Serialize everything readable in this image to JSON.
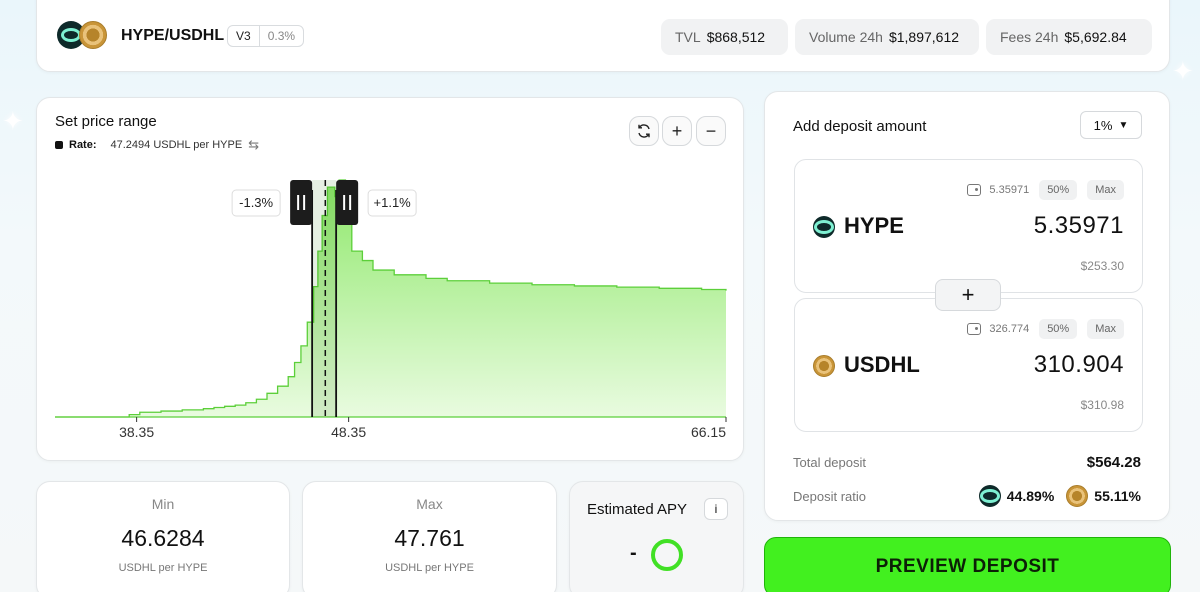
{
  "header": {
    "pair": "HYPE/USDHL",
    "version": "V3",
    "fee": "0.3%",
    "stats": [
      {
        "label": "TVL",
        "value": "$868,512"
      },
      {
        "label": "Volume 24h",
        "value": "$1,897,612"
      },
      {
        "label": "Fees 24h",
        "value": "$5,692.84"
      }
    ]
  },
  "range": {
    "title": "Set price range",
    "rate_label": "Rate:",
    "rate_value": "47.2494 USDHL per HYPE",
    "controls": [
      "refresh-icon",
      "zoom-in-icon",
      "zoom-out-icon"
    ]
  },
  "chart_data": {
    "type": "area",
    "x_ticks": [
      "38.35",
      "48.35",
      "66.15"
    ],
    "xlim": [
      34.5,
      66.15
    ],
    "current_price": 47.2494,
    "min_price": 46.6284,
    "max_price": 47.761,
    "min_label": "-1.3%",
    "max_label": "+1.1%",
    "x": [
      34.5,
      37.5,
      38.0,
      38.5,
      39.5,
      40.5,
      41.5,
      42.0,
      42.5,
      43.0,
      43.5,
      44.0,
      44.5,
      45.0,
      45.5,
      45.8,
      46.1,
      46.4,
      46.7,
      46.9,
      47.1,
      47.35,
      47.7,
      47.9,
      48.2,
      48.5,
      49.0,
      49.5,
      50.5,
      52.0,
      53.0,
      55.0,
      57.0,
      59.0,
      61.0,
      63.0,
      65.0,
      66.15
    ],
    "liquidity": [
      0,
      0,
      1,
      2,
      2.5,
      3,
      3.5,
      4,
      4.5,
      5,
      6,
      7.5,
      10,
      13,
      17,
      23,
      30,
      40,
      55,
      70,
      85,
      97,
      93,
      100,
      82,
      70,
      66,
      62,
      60,
      58.5,
      57.5,
      56.5,
      55.8,
      55.3,
      54.8,
      54.3,
      53.8,
      53.3
    ],
    "colors": {
      "fill_top": "#8ee86a",
      "fill_bottom": "#e9fbe0",
      "line": "#5ccf3a",
      "handle": "#1c1c1c"
    }
  },
  "min": {
    "title": "Min",
    "value": "46.6284",
    "unit": "USDHL per HYPE"
  },
  "max": {
    "title": "Max",
    "value": "47.761",
    "unit": "USDHL per HYPE"
  },
  "apy": {
    "title": "Estimated APY",
    "info": "i",
    "value": "-"
  },
  "deposit": {
    "title": "Add deposit amount",
    "slippage": "1%",
    "tokens": [
      {
        "name": "HYPE",
        "balance": "5.35971",
        "half": "50%",
        "max": "Max",
        "amount": "5.35971",
        "usd": "$253.30"
      },
      {
        "name": "USDHL",
        "balance": "326.774",
        "half": "50%",
        "max": "Max",
        "amount": "310.904",
        "usd": "$310.98"
      }
    ],
    "total_label": "Total deposit",
    "total_value": "$564.28",
    "ratio_label": "Deposit ratio",
    "ratio_hype": "44.89%",
    "ratio_usdhl": "55.11%"
  },
  "preview_button": "PREVIEW DEPOSIT"
}
